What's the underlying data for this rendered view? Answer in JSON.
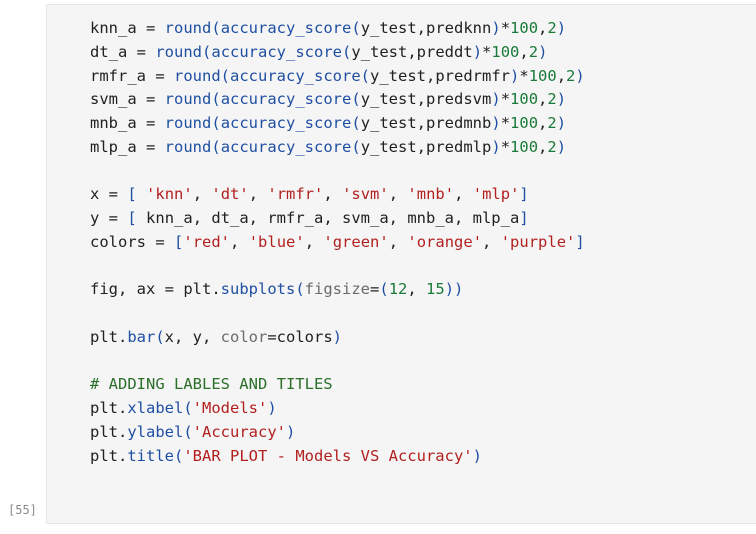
{
  "cell": {
    "prompt": "[55]",
    "lines": [
      [
        {
          "t": "knn_a "
        },
        {
          "t": "=",
          "c": "op"
        },
        {
          "t": " round",
          "c": "fn"
        },
        {
          "t": "(",
          "c": "pr"
        },
        {
          "t": "accuracy_score",
          "c": "fn"
        },
        {
          "t": "(",
          "c": "pr"
        },
        {
          "t": "y_test,predknn"
        },
        {
          "t": ")",
          "c": "pr"
        },
        {
          "t": "*"
        },
        {
          "t": "100",
          "c": "num"
        },
        {
          "t": ","
        },
        {
          "t": "2",
          "c": "num"
        },
        {
          "t": ")",
          "c": "pr"
        }
      ],
      [
        {
          "t": "dt_a "
        },
        {
          "t": "=",
          "c": "op"
        },
        {
          "t": " round",
          "c": "fn"
        },
        {
          "t": "(",
          "c": "pr"
        },
        {
          "t": "accuracy_score",
          "c": "fn"
        },
        {
          "t": "(",
          "c": "pr"
        },
        {
          "t": "y_test,preddt"
        },
        {
          "t": ")",
          "c": "pr"
        },
        {
          "t": "*"
        },
        {
          "t": "100",
          "c": "num"
        },
        {
          "t": ","
        },
        {
          "t": "2",
          "c": "num"
        },
        {
          "t": ")",
          "c": "pr"
        }
      ],
      [
        {
          "t": "rmfr_a "
        },
        {
          "t": "=",
          "c": "op"
        },
        {
          "t": " round",
          "c": "fn"
        },
        {
          "t": "(",
          "c": "pr"
        },
        {
          "t": "accuracy_score",
          "c": "fn"
        },
        {
          "t": "(",
          "c": "pr"
        },
        {
          "t": "y_test,predrmfr"
        },
        {
          "t": ")",
          "c": "pr"
        },
        {
          "t": "*"
        },
        {
          "t": "100",
          "c": "num"
        },
        {
          "t": ","
        },
        {
          "t": "2",
          "c": "num"
        },
        {
          "t": ")",
          "c": "pr"
        }
      ],
      [
        {
          "t": "svm_a "
        },
        {
          "t": "=",
          "c": "op"
        },
        {
          "t": " round",
          "c": "fn"
        },
        {
          "t": "(",
          "c": "pr"
        },
        {
          "t": "accuracy_score",
          "c": "fn"
        },
        {
          "t": "(",
          "c": "pr"
        },
        {
          "t": "y_test,predsvm"
        },
        {
          "t": ")",
          "c": "pr"
        },
        {
          "t": "*"
        },
        {
          "t": "100",
          "c": "num"
        },
        {
          "t": ","
        },
        {
          "t": "2",
          "c": "num"
        },
        {
          "t": ")",
          "c": "pr"
        }
      ],
      [
        {
          "t": "mnb_a "
        },
        {
          "t": "=",
          "c": "op"
        },
        {
          "t": " round",
          "c": "fn"
        },
        {
          "t": "(",
          "c": "pr"
        },
        {
          "t": "accuracy_score",
          "c": "fn"
        },
        {
          "t": "(",
          "c": "pr"
        },
        {
          "t": "y_test,predmnb"
        },
        {
          "t": ")",
          "c": "pr"
        },
        {
          "t": "*"
        },
        {
          "t": "100",
          "c": "num"
        },
        {
          "t": ","
        },
        {
          "t": "2",
          "c": "num"
        },
        {
          "t": ")",
          "c": "pr"
        }
      ],
      [
        {
          "t": "mlp_a "
        },
        {
          "t": "=",
          "c": "op"
        },
        {
          "t": " round",
          "c": "fn"
        },
        {
          "t": "(",
          "c": "pr"
        },
        {
          "t": "accuracy_score",
          "c": "fn"
        },
        {
          "t": "(",
          "c": "pr"
        },
        {
          "t": "y_test,predmlp"
        },
        {
          "t": ")",
          "c": "pr"
        },
        {
          "t": "*"
        },
        {
          "t": "100",
          "c": "num"
        },
        {
          "t": ","
        },
        {
          "t": "2",
          "c": "num"
        },
        {
          "t": ")",
          "c": "pr"
        }
      ],
      [],
      [
        {
          "t": "x "
        },
        {
          "t": "=",
          "c": "op"
        },
        {
          "t": " "
        },
        {
          "t": "[",
          "c": "pr"
        },
        {
          "t": " "
        },
        {
          "t": "'knn'",
          "c": "str"
        },
        {
          "t": ", "
        },
        {
          "t": "'dt'",
          "c": "str"
        },
        {
          "t": ", "
        },
        {
          "t": "'rmfr'",
          "c": "str"
        },
        {
          "t": ", "
        },
        {
          "t": "'svm'",
          "c": "str"
        },
        {
          "t": ", "
        },
        {
          "t": "'mnb'",
          "c": "str"
        },
        {
          "t": ", "
        },
        {
          "t": "'mlp'",
          "c": "str"
        },
        {
          "t": "]",
          "c": "pr"
        }
      ],
      [
        {
          "t": "y "
        },
        {
          "t": "=",
          "c": "op"
        },
        {
          "t": " "
        },
        {
          "t": "[",
          "c": "pr"
        },
        {
          "t": " knn_a, dt_a, rmfr_a, svm_a, mnb_a, mlp_a"
        },
        {
          "t": "]",
          "c": "pr"
        }
      ],
      [
        {
          "t": "colors "
        },
        {
          "t": "=",
          "c": "op"
        },
        {
          "t": " "
        },
        {
          "t": "[",
          "c": "pr"
        },
        {
          "t": "'red'",
          "c": "str"
        },
        {
          "t": ", "
        },
        {
          "t": "'blue'",
          "c": "str"
        },
        {
          "t": ", "
        },
        {
          "t": "'green'",
          "c": "str"
        },
        {
          "t": ", "
        },
        {
          "t": "'orange'",
          "c": "str"
        },
        {
          "t": ", "
        },
        {
          "t": "'purple'",
          "c": "str"
        },
        {
          "t": "]",
          "c": "pr"
        }
      ],
      [],
      [
        {
          "t": "fig, ax "
        },
        {
          "t": "=",
          "c": "op"
        },
        {
          "t": " plt."
        },
        {
          "t": "subplots",
          "c": "fn"
        },
        {
          "t": "(",
          "c": "pr"
        },
        {
          "t": "figsize",
          "c": "param"
        },
        {
          "t": "="
        },
        {
          "t": "(",
          "c": "pr"
        },
        {
          "t": "12",
          "c": "num"
        },
        {
          "t": ", "
        },
        {
          "t": "15",
          "c": "num"
        },
        {
          "t": "))",
          "c": "pr"
        }
      ],
      [],
      [
        {
          "t": "plt."
        },
        {
          "t": "bar",
          "c": "fn"
        },
        {
          "t": "(",
          "c": "pr"
        },
        {
          "t": "x, y, "
        },
        {
          "t": "color",
          "c": "param"
        },
        {
          "t": "=colors"
        },
        {
          "t": ")",
          "c": "pr"
        }
      ],
      [],
      [
        {
          "t": "# ADDING LABLES AND TITLES",
          "c": "cm"
        }
      ],
      [
        {
          "t": "plt."
        },
        {
          "t": "xlabel",
          "c": "fn"
        },
        {
          "t": "(",
          "c": "pr"
        },
        {
          "t": "'Models'",
          "c": "str"
        },
        {
          "t": ")",
          "c": "pr"
        }
      ],
      [
        {
          "t": "plt."
        },
        {
          "t": "ylabel",
          "c": "fn"
        },
        {
          "t": "(",
          "c": "pr"
        },
        {
          "t": "'Accuracy'",
          "c": "str"
        },
        {
          "t": ")",
          "c": "pr"
        }
      ],
      [
        {
          "t": "plt."
        },
        {
          "t": "title",
          "c": "fn"
        },
        {
          "t": "(",
          "c": "pr"
        },
        {
          "t": "'BAR PLOT - Models VS Accuracy'",
          "c": "str"
        },
        {
          "t": ")",
          "c": "pr"
        }
      ]
    ]
  }
}
